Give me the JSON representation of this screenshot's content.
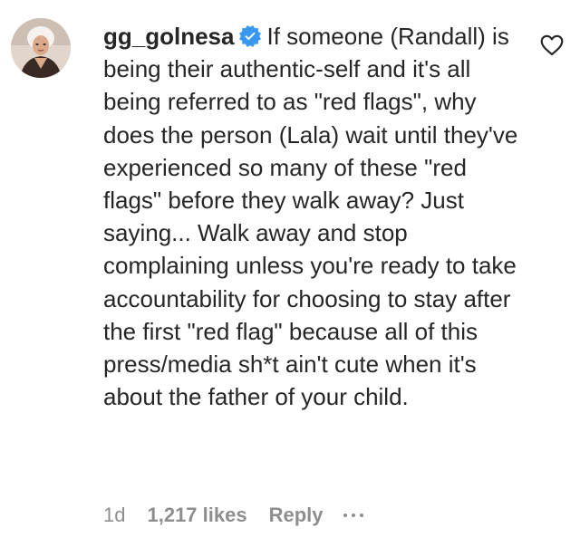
{
  "comment": {
    "username": "gg_golnesa",
    "verified": true,
    "text": "If someone (Randall) is being their authentic-self and it's all being referred to as \"red flags\", why does the person (Lala) wait until they've experienced so many of these \"red flags\" before they walk away? Just saying... Walk away and stop complaining unless you're ready to take accountability for choosing to stay after the first \"red flag\" because all of this press/media sh*t ain't cute when it's about the father of your child.",
    "time": "1d",
    "likes": "1,217 likes",
    "reply_label": "Reply"
  },
  "icons": {
    "avatar": "profile-avatar",
    "verified": "verified-badge-icon",
    "like": "heart-outline-icon",
    "more": "ellipsis-icon"
  },
  "colors": {
    "text": "#262626",
    "secondary": "#8e8e8e",
    "verified_blue": "#3897f0"
  }
}
